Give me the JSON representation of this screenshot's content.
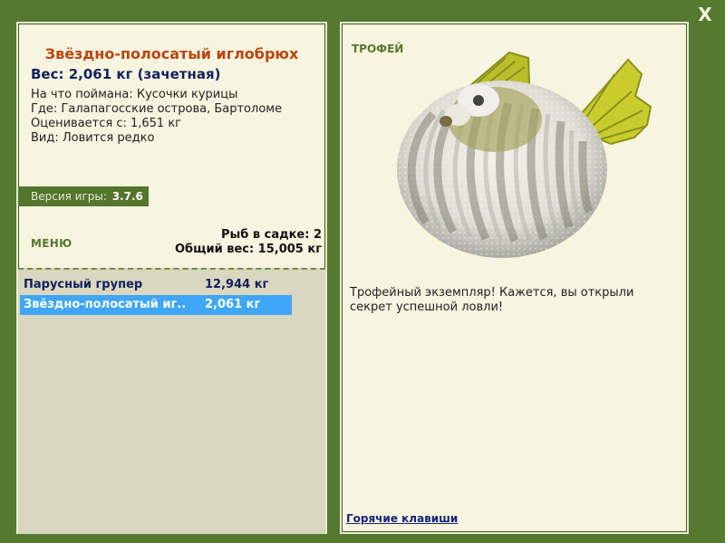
{
  "window": {
    "close_label": "X"
  },
  "fish_info": {
    "title": "Звёздно-полосатый иглобрюх",
    "weight_line": "Вес: 2,061 кг (зачетная)",
    "caught_with": "На что поймана: Кусочки курицы",
    "location": "Где: Галапагосские острова, Бартоломе",
    "valued_from": "Оценивается с: 1,651 кг",
    "species_rarity": "Вид: Ловится редко"
  },
  "game_version": {
    "label": "Версия игры:",
    "value": "3.7.6"
  },
  "menu": {
    "label": "МЕНЮ"
  },
  "keepnet": {
    "fish_count": "Рыб в садке: 2",
    "total_weight": "Общий вес: 15,005 кг",
    "items": [
      {
        "name": "Парусный групер",
        "weight": "12,944 кг",
        "selected": false
      },
      {
        "name": "Звёздно-полосатый иг...",
        "weight": "2,061 кг",
        "selected": true
      }
    ]
  },
  "right_panel": {
    "trophy_label": "ТРОФЕЙ",
    "trophy_message": "Трофейный экземпляр! Кажется, вы открыли секрет успешной ловли!",
    "hotkeys_label": "Горячие клавиши",
    "image_icon": "pufferfish-image"
  },
  "colors": {
    "background": "#55792f",
    "panel": "#f7f4df",
    "title": "#bb4510",
    "selected_row": "#40a6f7"
  }
}
